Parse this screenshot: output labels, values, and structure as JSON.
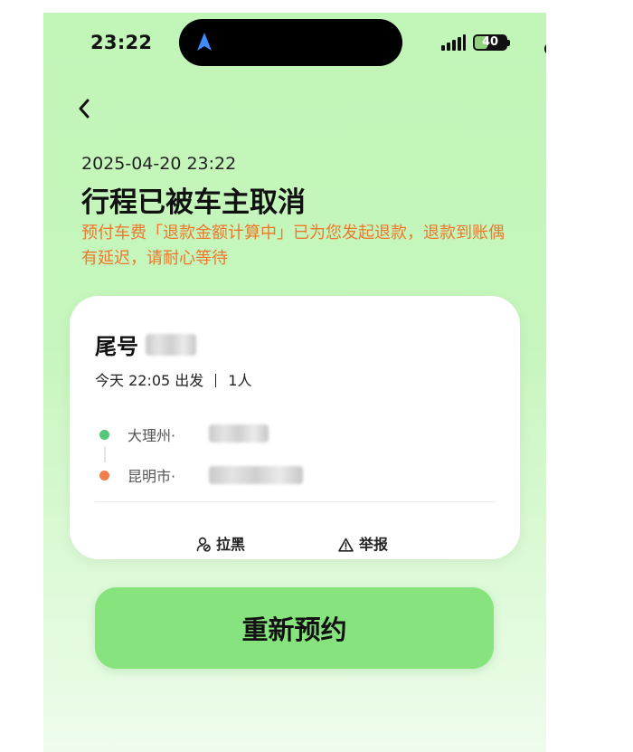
{
  "status_bar": {
    "time": "23:22",
    "battery": "40",
    "battery_level": 0.4,
    "nav_icon": "location-arrow-icon",
    "colors": {
      "island": "#000000",
      "battery_fill": "#8fd17f",
      "camera_dot": "#f39a2e"
    }
  },
  "header": {
    "back_icon": "chevron-left-icon",
    "datetime": "2025-04-20 23:22",
    "title": "行程已被车主取消",
    "notice": "预付车费「退款金额计算中」已为您发起退款，退款到账偶有延迟，请耐心等待"
  },
  "trip_card": {
    "plate_label": "尾号",
    "departure": "今天 22:05 出发",
    "passengers": "1人",
    "origin_city": "大理州·",
    "destination_city": "昆明市·",
    "actions": {
      "block": {
        "label": "拉黑",
        "icon": "user-block-icon"
      },
      "report": {
        "label": "举报",
        "icon": "warning-triangle-icon"
      }
    }
  },
  "primary_button": {
    "label": "重新预约"
  },
  "colors": {
    "background": "#c2f5b8",
    "notice_text": "#f0772b",
    "button": "#86e37d",
    "origin_dot": "#52c77a",
    "destination_dot": "#ef7e4e"
  }
}
